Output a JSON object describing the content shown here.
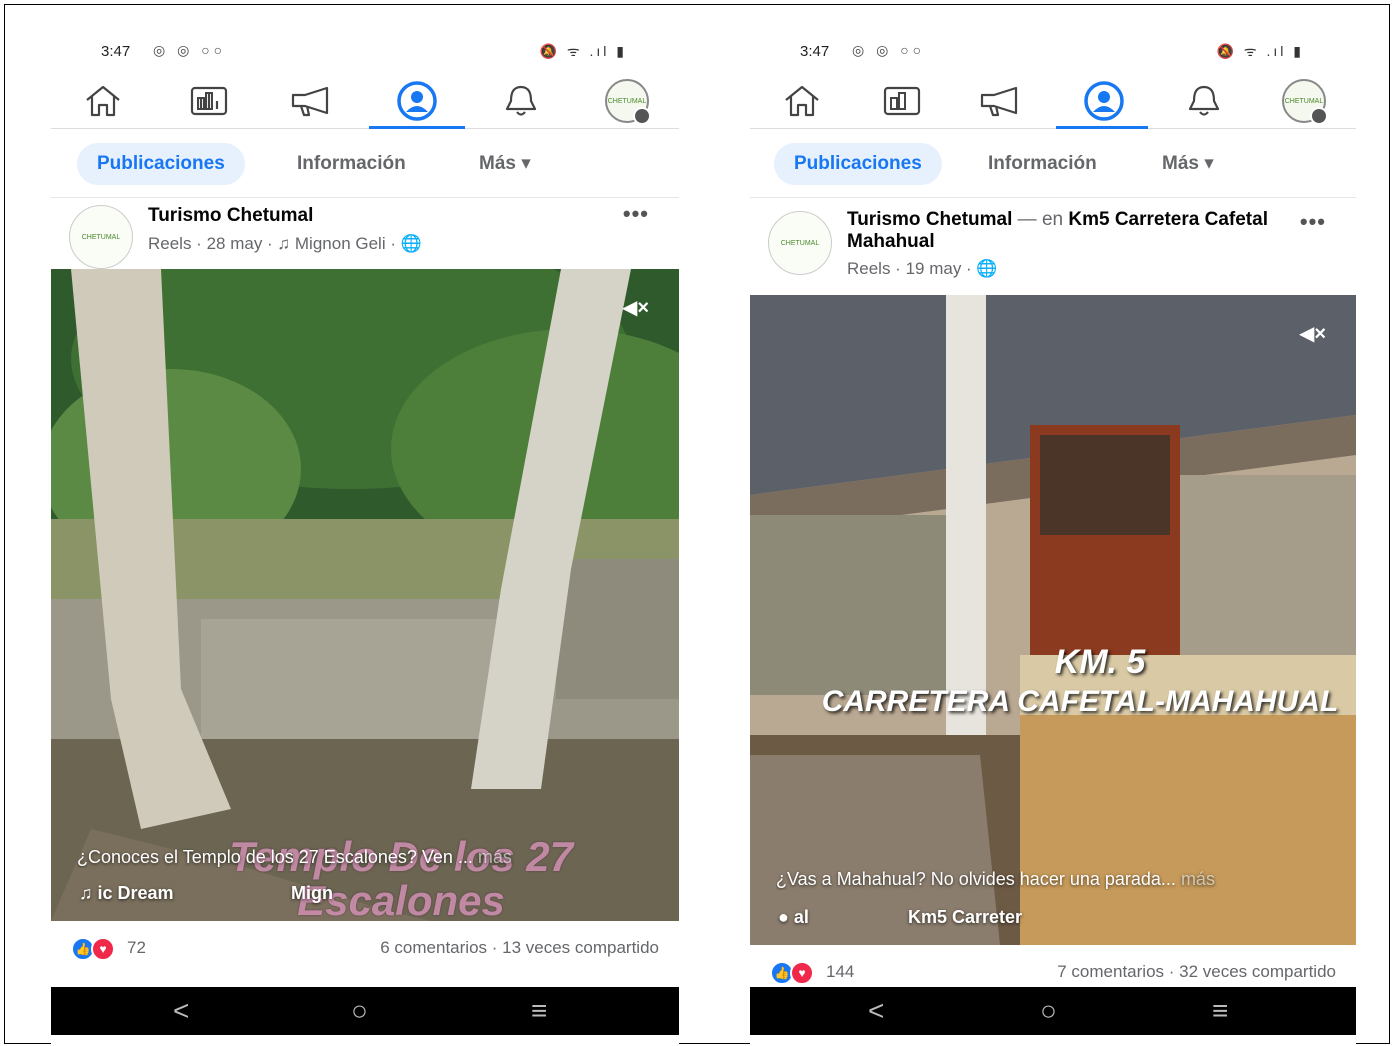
{
  "screens": [
    {
      "status": {
        "time": "3:47",
        "notifications": "◎ ◎ ○○",
        "right_icons": "🔕 ᯤ .ıl ▮"
      },
      "nav": {
        "icons": [
          "home-icon",
          "dashboard-icon",
          "megaphone-icon",
          "profile-icon",
          "bell-icon",
          "page-avatar-icon"
        ],
        "active": "profile-icon",
        "avatar_text": "CHETUMAL"
      },
      "tabs": [
        "Publicaciones",
        "Información",
        "Más ▾"
      ],
      "post": {
        "page_name": "Turismo Chetumal",
        "location_prefix": "",
        "location": "",
        "meta": "Reels · 28 may · ♫ Mignon Geli · 🌐",
        "more": "•••",
        "caption": "¿Conoces el Templo de los 27 Escalones? Ven ...",
        "caption_more": "más",
        "sub_left": "♫  ic Dream",
        "sub_right": "Mign",
        "overlay_title": "Templo De los 27 Escalones",
        "reaction_count": "72",
        "stats": "6 comentarios · 13 veces compartido"
      },
      "sysnav": {
        "back": "<",
        "home": "○",
        "recent": "≡"
      }
    },
    {
      "status": {
        "time": "3:47",
        "notifications": "◎ ◎ ○○",
        "right_icons": "🔕 ᯤ .ıl ▮"
      },
      "nav": {
        "icons": [
          "home-icon",
          "dashboard-icon",
          "megaphone-icon",
          "profile-icon",
          "bell-icon",
          "page-avatar-icon"
        ],
        "active": "profile-icon",
        "avatar_text": "CHETUMAL"
      },
      "tabs": [
        "Publicaciones",
        "Información",
        "Más ▾"
      ],
      "post": {
        "page_name": "Turismo Chetumal",
        "location_prefix": " — en ",
        "location": "Km5 Carretera Cafetal Mahahual",
        "meta": "Reels · 19 may · 🌐",
        "more": "•••",
        "caption": "¿Vas a Mahahual? No olvides hacer una parada...",
        "caption_more": "más",
        "sub_left": "●  al",
        "sub_right": "Km5 Carreter",
        "km_line1": "KM. 5",
        "km_line2": "CARRETERA CAFETAL-MAHAHUAL",
        "reaction_count": "144",
        "stats": "7 comentarios · 32 veces compartido"
      },
      "sysnav": {
        "back": "<",
        "home": "○",
        "recent": "≡"
      }
    }
  ],
  "colors": {
    "accent": "#1877f2",
    "like": "#1877f2",
    "love": "#f02849",
    "tab_active_bg": "#e7f0fd"
  }
}
